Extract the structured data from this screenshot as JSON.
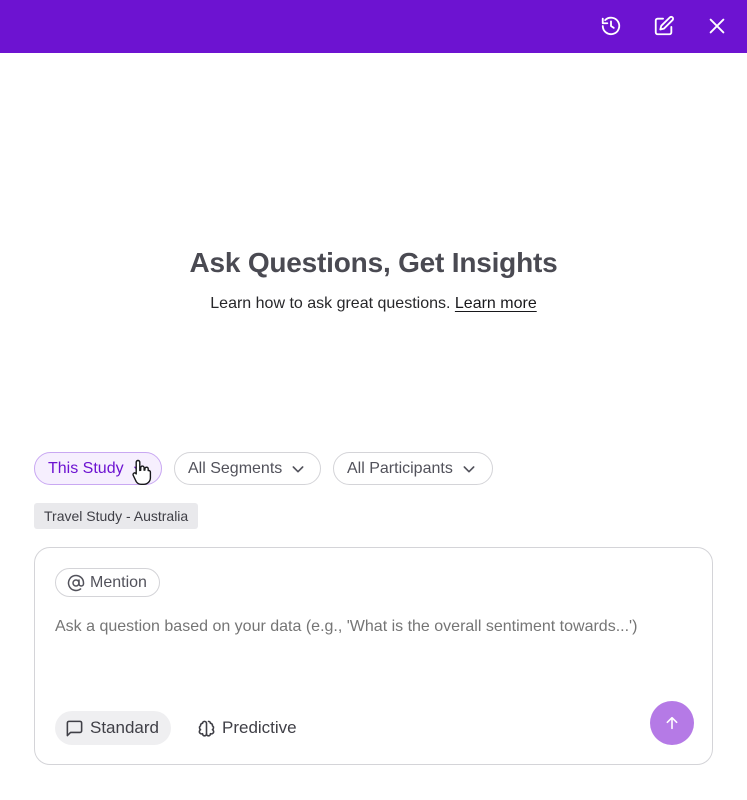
{
  "header": {
    "icons": [
      "history-icon",
      "edit-icon",
      "close-icon"
    ],
    "background": "#6d13d1"
  },
  "hero": {
    "title": "Ask Questions, Get Insights",
    "subtitle": "Learn how to ask great questions.",
    "link_label": "Learn more"
  },
  "filters": {
    "scope_label": "This Study",
    "segments_label": "All Segments",
    "participants_label": "All Participants"
  },
  "selected_study_tag": "Travel Study - Australia",
  "composer": {
    "mention_label": "Mention",
    "placeholder": "Ask a question based on your data (e.g., 'What is the overall sentiment towards...')",
    "modes": {
      "standard_label": "Standard",
      "predictive_label": "Predictive",
      "selected": "Standard"
    },
    "send_icon": "arrow-up-icon",
    "accent": "#b57ae6"
  }
}
